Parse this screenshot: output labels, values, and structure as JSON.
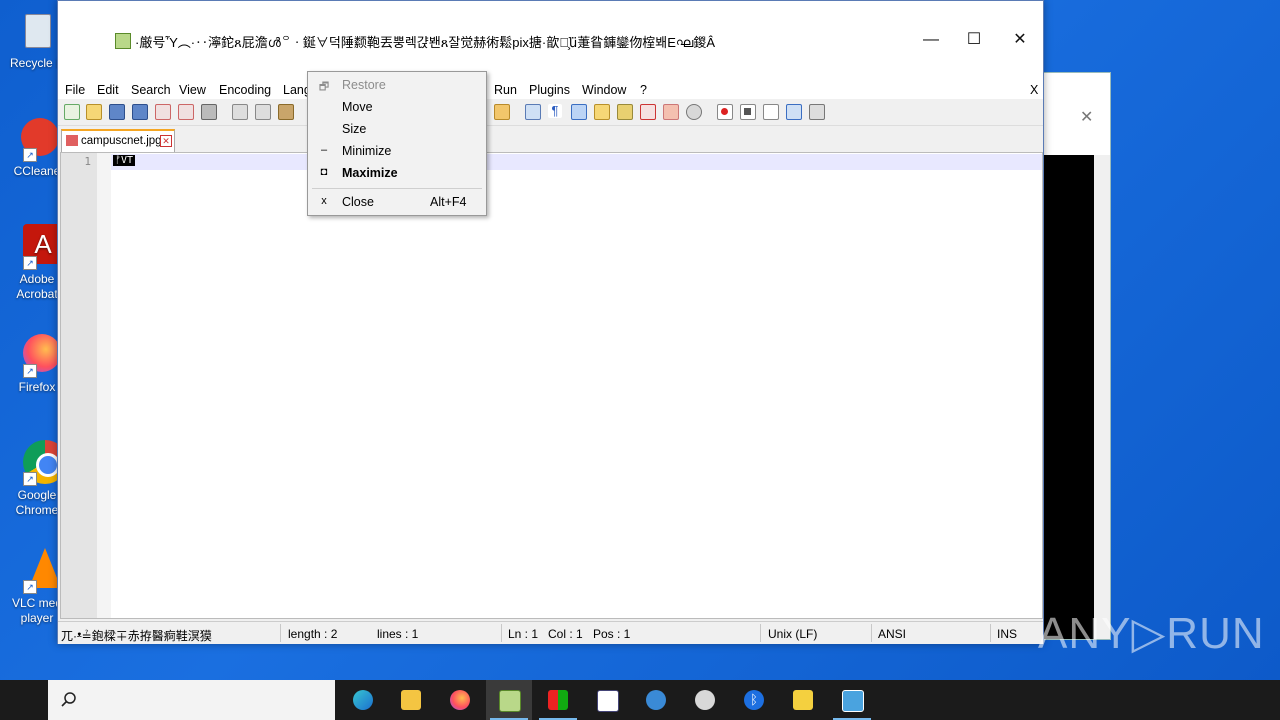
{
  "desktop": {
    "icons": [
      {
        "label": "Recycle B"
      },
      {
        "label": "CCleane"
      },
      {
        "label": "Adobe Acrobat"
      },
      {
        "label": "Firefox"
      },
      {
        "label": "Google Chrome"
      },
      {
        "label": "VLC med player"
      }
    ]
  },
  "window": {
    "title": "·厳号Ὗ︵·‥濘鉈ጸ屁澹ൾ꒪ㆍ鋋∀덕陲颣鞄丟뿡렉갽봰ጸ잘觉赫術鬆pix搪·歆끈̧ն̈萐䀤龲鑾伆榁봬Eഘ鍐Â",
    "controls": {
      "minimize": "—",
      "maximize": "☐",
      "close": "✕"
    }
  },
  "menu": {
    "items": [
      "File",
      "Edit",
      "Search",
      "View",
      "Encoding",
      "Lang",
      "Run",
      "Plugins",
      "Window",
      "?"
    ],
    "close_x": "X"
  },
  "tab": {
    "label": "campuscnet.jpg",
    "close": "✕"
  },
  "editor": {
    "line_number": "1",
    "content": "ᚠVT"
  },
  "status": {
    "left": "兀·ᵜ≟鉋樑∓赤拵醫痾鞋溟獏",
    "length": "length : 2",
    "lines": "lines : 1",
    "ln": "Ln : 1",
    "col": "Col : 1",
    "pos": "Pos : 1",
    "eol": "Unix (LF)",
    "encoding": "ANSI",
    "mode": "INS"
  },
  "context_menu": {
    "items": [
      {
        "icon": "🗗",
        "label": "Restore",
        "shortcut": "",
        "disabled": true,
        "bold": false
      },
      {
        "icon": "",
        "label": "Move",
        "shortcut": "",
        "disabled": false,
        "bold": false
      },
      {
        "icon": "",
        "label": "Size",
        "shortcut": "",
        "disabled": false,
        "bold": false
      },
      {
        "icon": "–",
        "label": "Minimize",
        "shortcut": "",
        "disabled": false,
        "bold": false
      },
      {
        "icon": "◘",
        "label": "Maximize",
        "shortcut": "",
        "disabled": false,
        "bold": true
      },
      {
        "icon": "x",
        "label": "Close",
        "shortcut": "Alt+F4",
        "disabled": false,
        "bold": false
      }
    ]
  },
  "watermark": "ANY▷RUN",
  "colors": {
    "desktop": "#1565d0",
    "taskbar": "#1b1b1b",
    "tab_accent": "#f5a623"
  }
}
